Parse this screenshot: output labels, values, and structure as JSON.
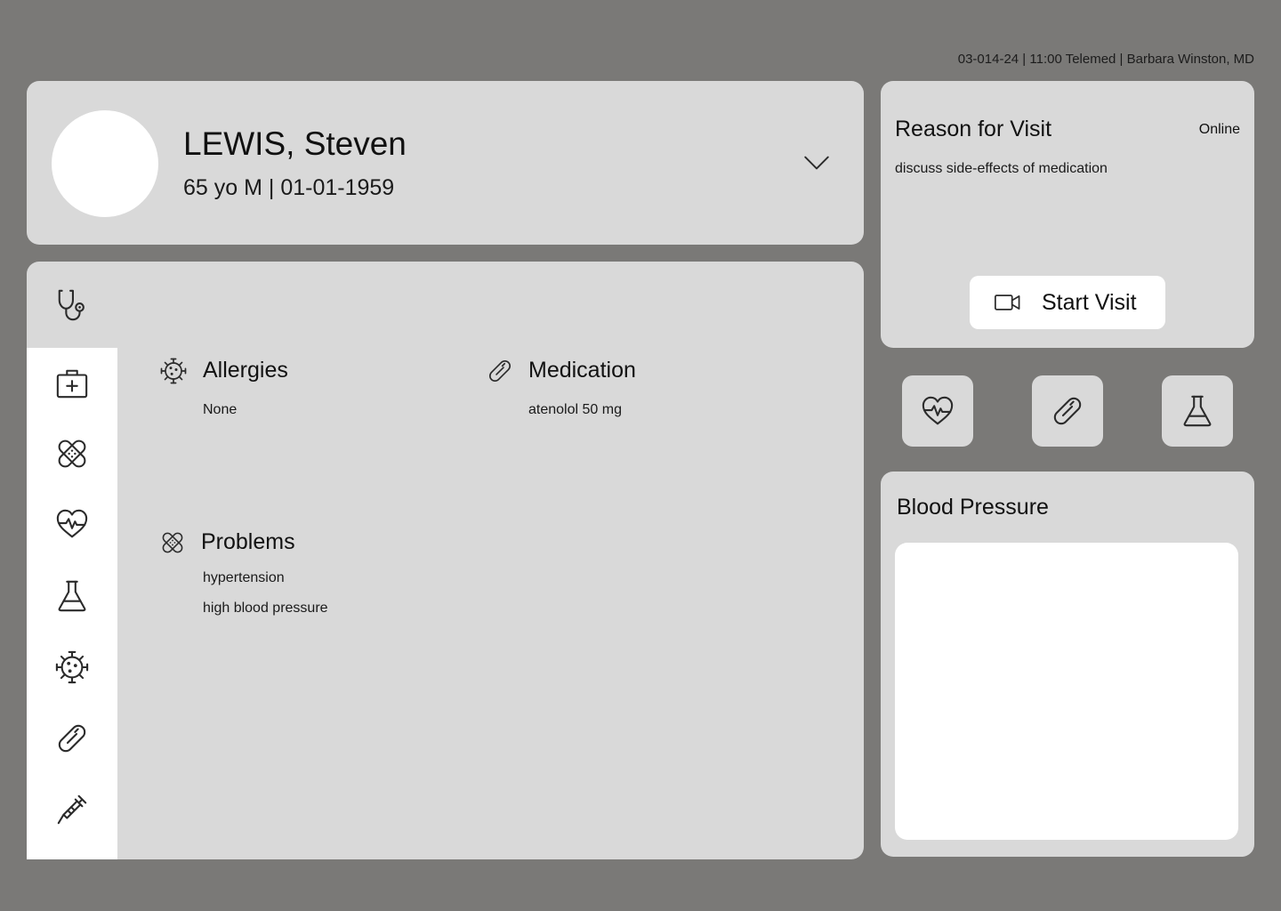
{
  "header": {
    "appointment_info": "03-014-24 | 11:00 Telemed | Barbara Winston, MD"
  },
  "patient": {
    "name": "LEWIS, Steven",
    "meta": "65 yo M | 01-01-1959"
  },
  "sidebar": {
    "top_icon": "stethoscope-icon",
    "items": [
      {
        "icon": "medical-kit-icon"
      },
      {
        "icon": "bandage-icon"
      },
      {
        "icon": "heart-pulse-icon"
      },
      {
        "icon": "flask-icon"
      },
      {
        "icon": "virus-icon"
      },
      {
        "icon": "pill-icon"
      },
      {
        "icon": "syringe-icon"
      }
    ]
  },
  "sections": {
    "allergies": {
      "title": "Allergies",
      "items": [
        "None"
      ]
    },
    "medication": {
      "title": "Medication",
      "items": [
        "atenolol 50 mg"
      ]
    },
    "problems": {
      "title": "Problems",
      "items": [
        "hypertension",
        "high blood pressure"
      ]
    }
  },
  "visit": {
    "title": "Reason for Visit",
    "status": "Online",
    "reason": "discuss side-effects of medication",
    "start_label": "Start Visit"
  },
  "quick_actions": [
    {
      "icon": "heart-pulse-icon"
    },
    {
      "icon": "pill-icon"
    },
    {
      "icon": "flask-icon"
    }
  ],
  "blood_pressure": {
    "title": "Blood Pressure"
  },
  "colors": {
    "background": "#7a7977",
    "card": "#d9d9d9",
    "surface": "#ffffff",
    "icon": "#2b2b2b"
  }
}
